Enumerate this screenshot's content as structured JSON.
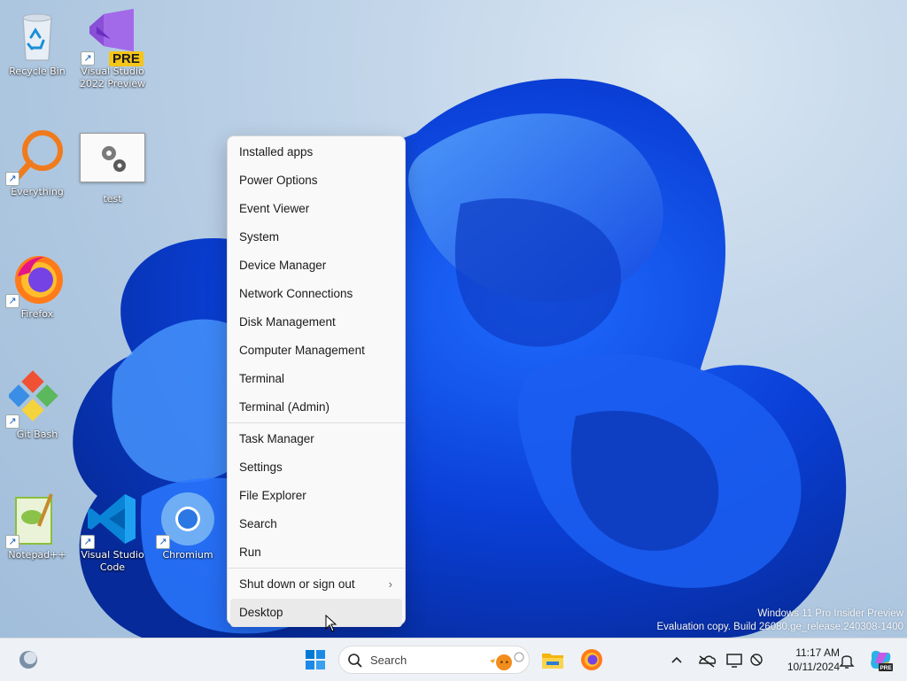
{
  "desktop": {
    "icons": [
      {
        "label": "Recycle Bin",
        "icon": "recycle-bin-icon"
      },
      {
        "label": "Visual Studio 2022 Preview",
        "line1": "Visual Studio",
        "line2": "2022 Preview",
        "badge": "PRE",
        "icon": "visual-studio-icon"
      },
      {
        "label": "Everything",
        "icon": "everything-search-icon"
      },
      {
        "label": "test",
        "icon": "gear-icon"
      },
      {
        "label": "Firefox",
        "icon": "firefox-icon"
      },
      {
        "label": "Git Bash",
        "icon": "git-bash-icon"
      },
      {
        "label": "Notepad++",
        "icon": "notepad-plus-plus-icon"
      },
      {
        "label": "Visual Studio Code",
        "line1": "Visual Studio",
        "line2": "Code",
        "icon": "vscode-icon"
      },
      {
        "label": "Chromium",
        "icon": "chromium-icon"
      }
    ]
  },
  "context_menu": {
    "group1": [
      "Installed apps",
      "Power Options",
      "Event Viewer",
      "System",
      "Device Manager",
      "Network Connections",
      "Disk Management",
      "Computer Management",
      "Terminal",
      "Terminal (Admin)"
    ],
    "group2": [
      "Task Manager",
      "Settings",
      "File Explorer",
      "Search",
      "Run"
    ],
    "group3": [
      {
        "label": "Shut down or sign out",
        "submenu": true
      },
      {
        "label": "Desktop",
        "highlighted": true
      }
    ]
  },
  "watermark": {
    "line1": "Windows 11 Pro Insider Preview",
    "line2": "Evaluation copy. Build 26080.ge_release.240308-1400"
  },
  "taskbar": {
    "search_placeholder": "Search",
    "time": "11:17 AM",
    "date": "10/11/2024",
    "pinned": [
      "windows-start-icon",
      "file-explorer-icon",
      "firefox-icon"
    ],
    "tray": [
      "chevron-up-icon",
      "onedrive-icon",
      "display-icon",
      "network-icon",
      "notification-bell-icon",
      "copilot-pre-icon"
    ]
  },
  "colors": {
    "accent": "#0067c0",
    "taskbar_bg": "#eef1f5",
    "menu_bg": "#f9f9f9"
  }
}
